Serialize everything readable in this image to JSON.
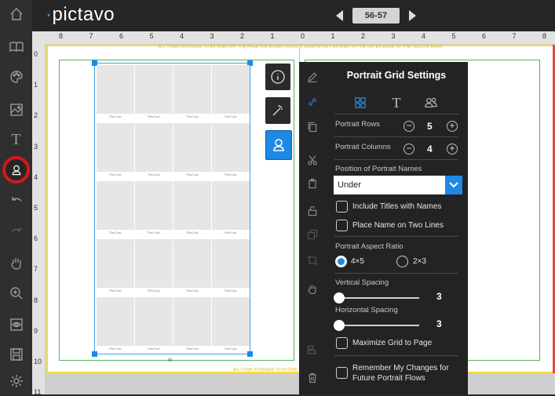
{
  "app": {
    "logo": "pictavo",
    "page_indicator": "56-57"
  },
  "rulers": {
    "top": [
      "8",
      "7",
      "6",
      "5",
      "4",
      "3",
      "2",
      "1",
      "0",
      "1",
      "2",
      "3",
      "4",
      "5",
      "6",
      "7",
      "8"
    ],
    "left": [
      "0",
      "1",
      "2",
      "3",
      "4",
      "5",
      "6",
      "7",
      "8",
      "9",
      "10",
      "11"
    ]
  },
  "canvas": {
    "bleed_notice": "ALL ITEMS INTENDED TO EXTEND OFF THE PAGE (OR BLEED) SHOULD COMPLETELY EXTEND TO THE OUTER EDGE OF THE YELLOW AREA.",
    "bleed_notice_bottom": "ALL ITEMS INTENDED TO EXTEND OFF THE PAGE (OR BLEED) SHOULD",
    "page_number": "56",
    "portrait_name": "First Last"
  },
  "panel": {
    "title": "Portrait Grid Settings",
    "rows_label": "Portrait Rows",
    "rows_value": "5",
    "columns_label": "Portrait Columns",
    "columns_value": "4",
    "position_label": "Position of Portrait Names",
    "position_value": "Under",
    "include_titles": "Include Titles with Names",
    "two_lines": "Place Name on Two Lines",
    "aspect_label": "Portrait Aspect Ratio",
    "aspect_opt1": "4×5",
    "aspect_opt2": "2×3",
    "vspacing_label": "Vertical Spacing",
    "vspacing_value": "3",
    "hspacing_label": "Horizontal Spacing",
    "hspacing_value": "3",
    "maximize": "Maximize Grid to Page",
    "remember_line1": "Remember My Changes for",
    "remember_line2": "Future Portrait Flows"
  },
  "colors": {
    "accent": "#1e88e5",
    "highlight_ring": "#d6161c",
    "bleed": "#f2dc3e",
    "safe_zone": "#56b25c"
  }
}
